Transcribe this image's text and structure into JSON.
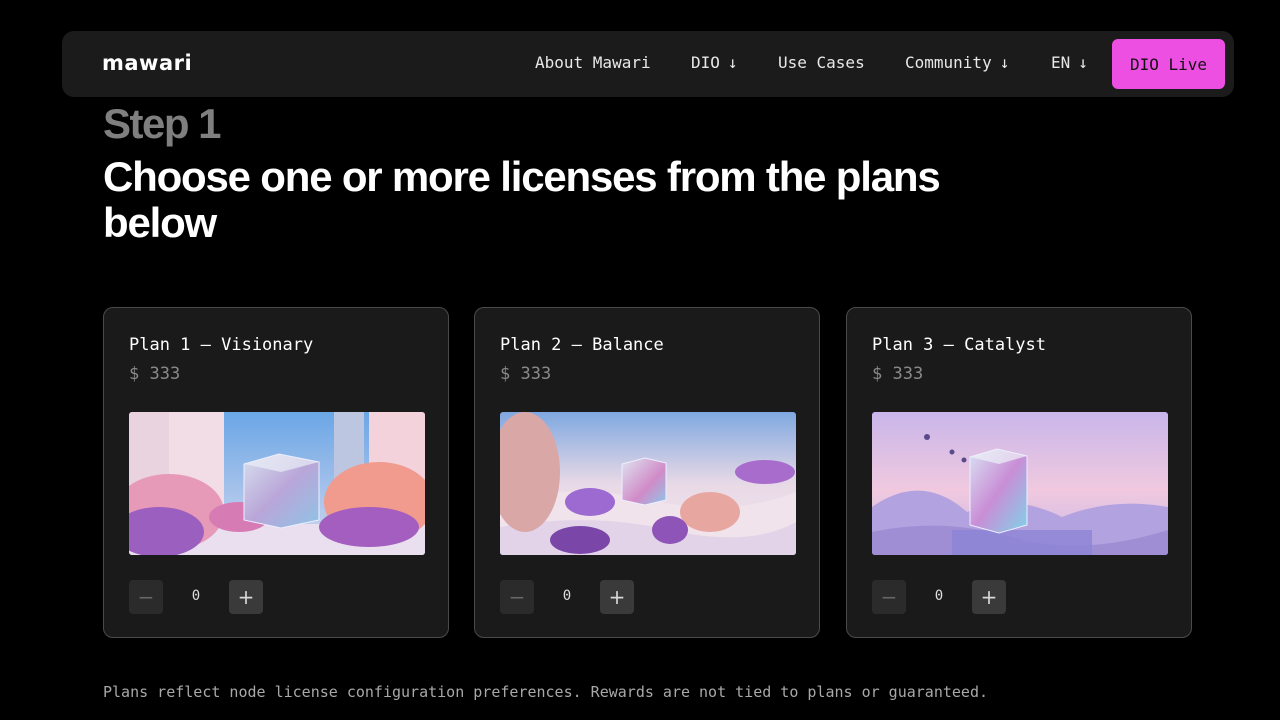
{
  "nav": {
    "logo": "mawari",
    "links": [
      {
        "label": "About Mawari",
        "arrow": ""
      },
      {
        "label": "DIO",
        "arrow": "↓"
      },
      {
        "label": "Use Cases",
        "arrow": ""
      },
      {
        "label": "Community",
        "arrow": "↓"
      },
      {
        "label": "EN",
        "arrow": "↓"
      }
    ],
    "cta_label": "DIO Live",
    "cta_color": "#ee4fe3"
  },
  "hero": {
    "step": "Step 1",
    "title": "Choose one or more licenses from the plans below"
  },
  "plans": [
    {
      "title": "Plan 1 — Visionary",
      "price": "$ 333",
      "quantity": "0",
      "image": "cube-in-pink-city"
    },
    {
      "title": "Plan 2 — Balance",
      "price": "$ 333",
      "quantity": "0",
      "image": "cube-in-coral-desert"
    },
    {
      "title": "Plan 3 — Catalyst",
      "price": "$ 333",
      "quantity": "0",
      "image": "cube-in-violet-dunes"
    }
  ],
  "stepper": {
    "minus_icon": "minus-icon",
    "plus_icon": "plus-icon"
  },
  "disclaimer": "Plans reflect node license configuration preferences. Rewards are not tied to plans or guaranteed."
}
